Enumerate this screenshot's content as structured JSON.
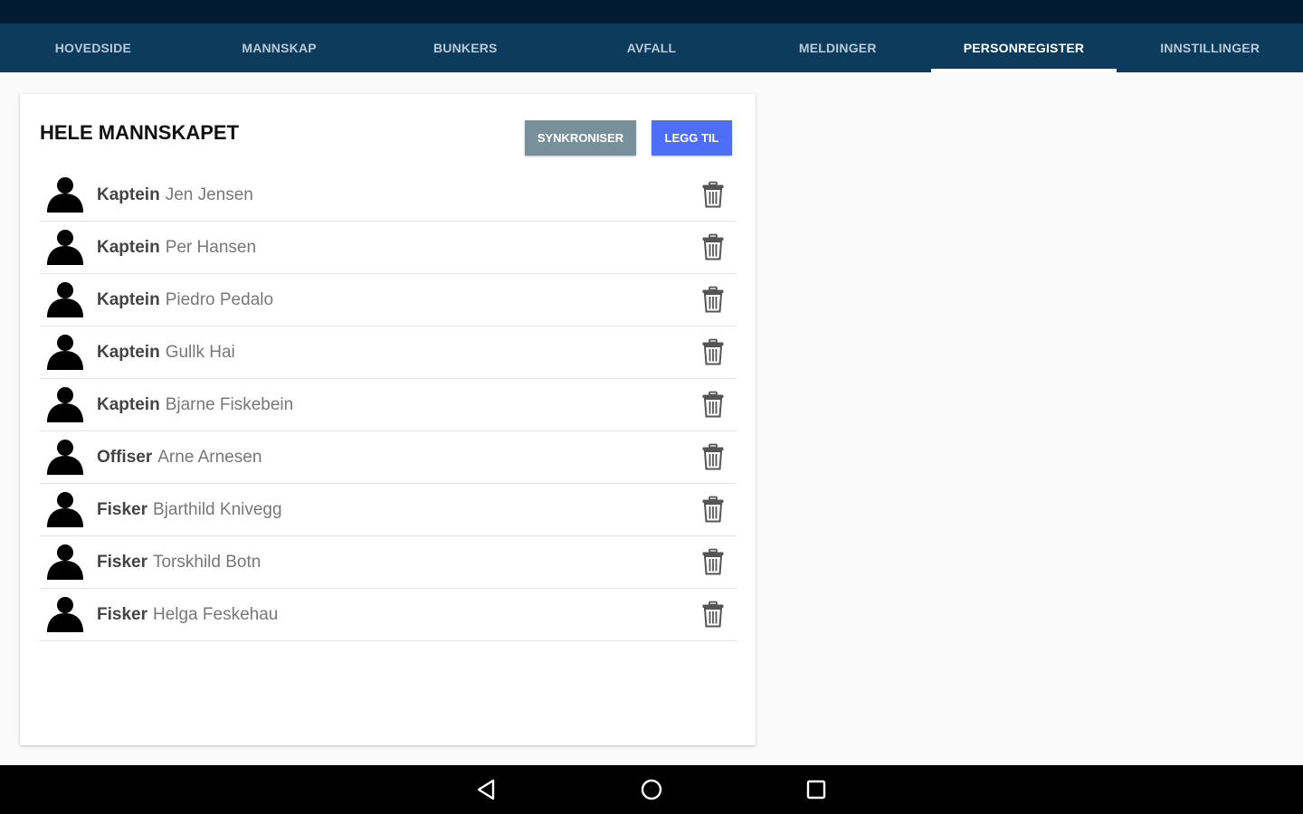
{
  "tabs": [
    {
      "label": "HOVEDSIDE",
      "active": false
    },
    {
      "label": "MANNSKAP",
      "active": false
    },
    {
      "label": "BUNKERS",
      "active": false
    },
    {
      "label": "AVFALL",
      "active": false
    },
    {
      "label": "MELDINGER",
      "active": false
    },
    {
      "label": "PERSONREGISTER",
      "active": true
    },
    {
      "label": "INNSTILLINGER",
      "active": false
    }
  ],
  "card": {
    "title": "HELE MANNSKAPET",
    "sync_label": "SYNKRONISER",
    "add_label": "LEGG TIL"
  },
  "crew": [
    {
      "rank": "Kaptein",
      "name": "Jen Jensen"
    },
    {
      "rank": "Kaptein",
      "name": "Per Hansen"
    },
    {
      "rank": "Kaptein",
      "name": "Piedro Pedalo"
    },
    {
      "rank": "Kaptein",
      "name": "Gullk Hai"
    },
    {
      "rank": "Kaptein",
      "name": "Bjarne Fiskebein"
    },
    {
      "rank": "Offiser",
      "name": "Arne Arnesen"
    },
    {
      "rank": "Fisker",
      "name": "Bjarthild Knivegg"
    },
    {
      "rank": "Fisker",
      "name": "Torskhild Botn"
    },
    {
      "rank": "Fisker",
      "name": "Helga Feskehau"
    }
  ],
  "icons": {
    "avatar": "person-icon",
    "delete": "trash-icon",
    "nav_back": "back-triangle-icon",
    "nav_home": "home-circle-icon",
    "nav_recents": "recents-square-icon"
  },
  "colors": {
    "statusbar": "#021a33",
    "tabbar": "#0d3b5c",
    "sync_button": "#78909c",
    "add_button": "#4f6ef7"
  }
}
